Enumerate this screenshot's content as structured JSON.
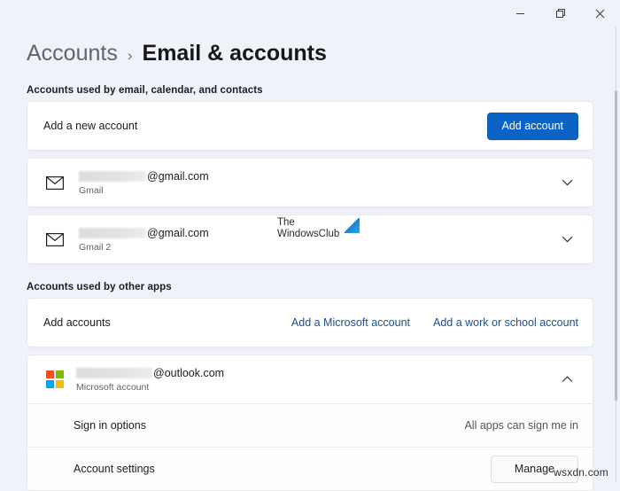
{
  "window": {
    "controls": [
      {
        "name": "minimize",
        "glyph": "minimize-icon"
      },
      {
        "name": "restore",
        "glyph": "restore-icon"
      },
      {
        "name": "close",
        "glyph": "close-icon"
      }
    ]
  },
  "header": {
    "breadcrumb_parent": "Accounts",
    "breadcrumb_separator": "›",
    "breadcrumb_current": "Email & accounts"
  },
  "sections": [
    {
      "label": "Accounts used by email, calendar, and contacts",
      "rows": [
        {
          "kind": "add-new",
          "title": "Add a new account",
          "button": "Add account"
        },
        {
          "kind": "account",
          "icon": "envelope-icon",
          "email_domain": "@gmail.com",
          "provider": "Gmail",
          "expanded": false
        },
        {
          "kind": "account",
          "icon": "envelope-icon",
          "email_domain": "@gmail.com",
          "provider": "Gmail 2",
          "expanded": false
        }
      ]
    },
    {
      "label": "Accounts used by other apps",
      "rows": [
        {
          "kind": "add-accounts",
          "title": "Add accounts",
          "links": [
            "Add a Microsoft account",
            "Add a work or school account"
          ]
        },
        {
          "kind": "account-expanded",
          "icon": "microsoft-logo-icon",
          "email_domain": "@outlook.com",
          "provider": "Microsoft account",
          "expanded": true,
          "subrows": [
            {
              "label": "Sign in options",
              "value": "All apps can sign me in"
            },
            {
              "label": "Account settings",
              "button": "Manage"
            }
          ]
        }
      ]
    }
  ],
  "watermarks": {
    "brand_line1": "The",
    "brand_line2": "WindowsClub",
    "corner": "wsxdn.com"
  },
  "colors": {
    "page_background": "#eff2f9",
    "card_background": "#ffffff",
    "accent_button": "#0b63c5",
    "link": "#1d4e8f",
    "ms_red": "#f25022",
    "ms_green": "#7fba00",
    "ms_blue": "#00a4ef",
    "ms_yellow": "#ffb900"
  }
}
